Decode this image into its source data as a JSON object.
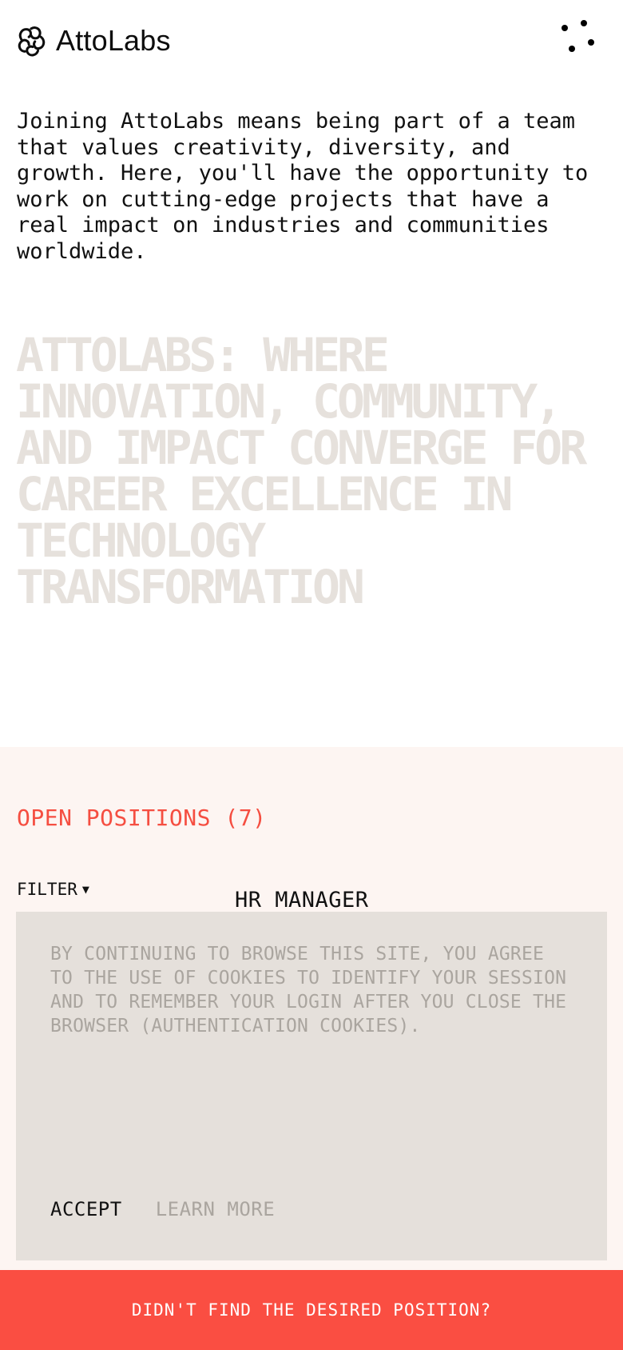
{
  "header": {
    "brand": "AttoLabs",
    "logo_icon": "attolabs-knot-icon",
    "menu_icon": "dots-menu-icon"
  },
  "intro": {
    "text": "Joining AttoLabs means being part of a team that values creativity, diversity, and growth. Here, you'll have the opportunity to work on cutting-edge projects that have a real impact on industries and communities worldwide."
  },
  "headline": {
    "text": "ATTOLABS: WHERE INNOVATION, COMMUNITY, AND IMPACT CONVERGE FOR CAREER EXCELLENCE IN TECHNOLOGY TRANSFORMATION"
  },
  "positions": {
    "title": "OPEN POSITIONS (7)",
    "filter_label": "FILTER",
    "filter_icon": "caret-down-icon",
    "job_title": "HR MANAGER"
  },
  "cookie_banner": {
    "text": "BY CONTINUING TO BROWSE THIS SITE, YOU AGREE TO THE USE OF COOKIES TO IDENTIFY YOUR SESSION AND TO REMEMBER YOUR LOGIN AFTER YOU CLOSE THE BROWSER (AUTHENTICATION COOKIES).",
    "accept_label": "ACCEPT",
    "learn_more_label": "LEARN MORE"
  },
  "cta": {
    "label": "DIDN'T FIND THE DESIRED POSITION?"
  },
  "colors": {
    "accent": "#fa4e42",
    "accent_text": "#f54e41",
    "section_bg": "#fdf5f2",
    "cookie_bg": "#e5e0db",
    "headline": "#e6e1dc"
  }
}
